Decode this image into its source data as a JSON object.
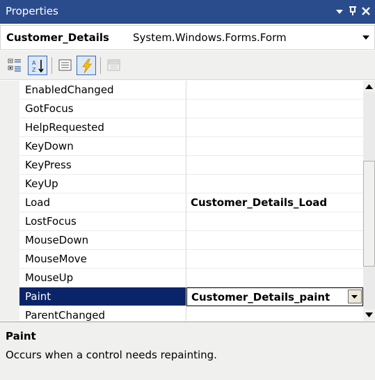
{
  "window": {
    "title": "Properties",
    "controls": [
      "dropdown-icon",
      "pin-icon",
      "close-icon"
    ]
  },
  "object_selector": {
    "name": "Customer_Details",
    "type": "System.Windows.Forms.Form"
  },
  "toolbar": {
    "buttons": [
      {
        "icon": "categorized-icon",
        "selected": false
      },
      {
        "icon": "alphabetical-icon",
        "selected": true
      },
      {
        "icon": "properties-icon",
        "selected": false
      },
      {
        "icon": "events-icon",
        "selected": true
      },
      {
        "icon": "property-pages-icon",
        "selected": false
      }
    ]
  },
  "events": [
    {
      "name": "EnabledChanged",
      "value": ""
    },
    {
      "name": "GotFocus",
      "value": ""
    },
    {
      "name": "HelpRequested",
      "value": ""
    },
    {
      "name": "KeyDown",
      "value": ""
    },
    {
      "name": "KeyPress",
      "value": ""
    },
    {
      "name": "KeyUp",
      "value": ""
    },
    {
      "name": "Load",
      "value": "Customer_Details_Load"
    },
    {
      "name": "LostFocus",
      "value": ""
    },
    {
      "name": "MouseDown",
      "value": ""
    },
    {
      "name": "MouseMove",
      "value": ""
    },
    {
      "name": "MouseUp",
      "value": ""
    },
    {
      "name": "Paint",
      "value": "Customer_Details_paint"
    },
    {
      "name": "ParentChanged",
      "value": ""
    }
  ],
  "selected_event": "Paint",
  "description": {
    "title": "Paint",
    "text": "Occurs when a control needs repainting."
  },
  "colors": {
    "titlebar": "#2b4c8c",
    "selection": "#0a246a",
    "toolbar_bg": "#f0f0ee"
  }
}
